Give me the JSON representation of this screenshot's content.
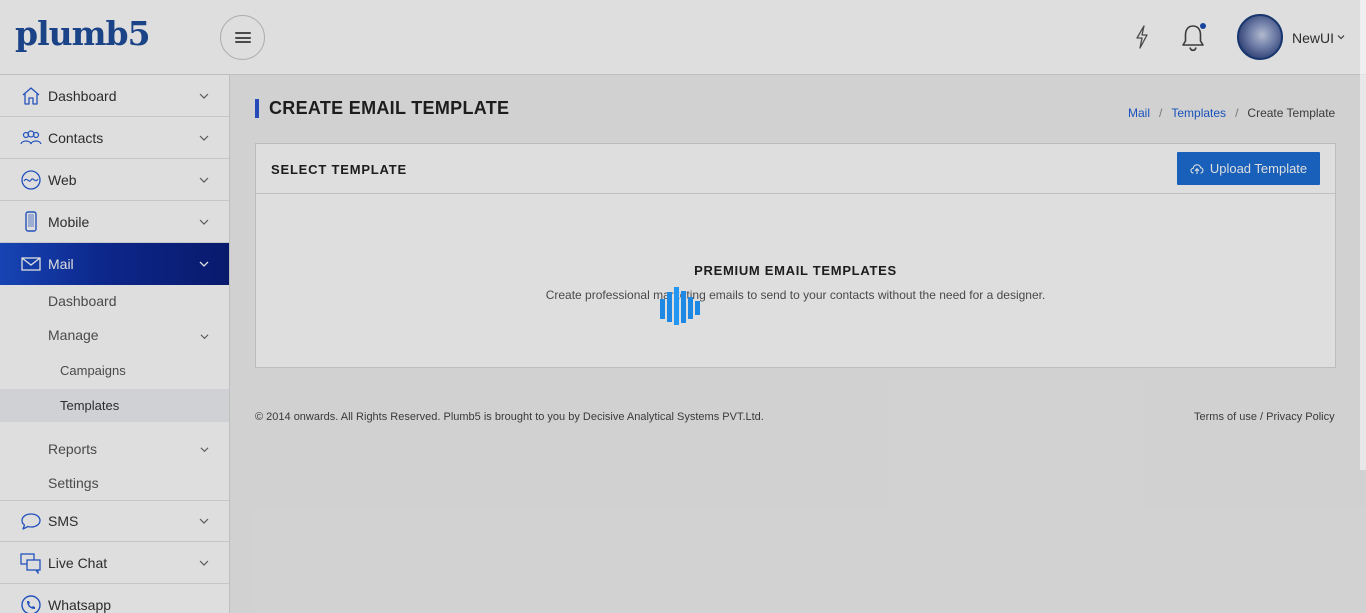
{
  "header": {
    "logo_text": "plumb5",
    "user_name": "NewUI"
  },
  "sidebar": {
    "items": [
      {
        "label": "Dashboard",
        "icon": "home-icon"
      },
      {
        "label": "Contacts",
        "icon": "contacts-icon"
      },
      {
        "label": "Web",
        "icon": "web-icon"
      },
      {
        "label": "Mobile",
        "icon": "mobile-icon"
      },
      {
        "label": "Mail",
        "icon": "mail-icon",
        "active": true
      },
      {
        "label": "SMS",
        "icon": "sms-icon"
      },
      {
        "label": "Live Chat",
        "icon": "live-chat-icon"
      },
      {
        "label": "Whatsapp",
        "icon": "whatsapp-icon"
      }
    ],
    "mail_sub": {
      "dashboard": "Dashboard",
      "manage": "Manage",
      "campaigns": "Campaigns",
      "templates": "Templates",
      "reports": "Reports",
      "settings": "Settings"
    }
  },
  "page": {
    "title": "CREATE EMAIL TEMPLATE",
    "breadcrumb": [
      "Mail",
      "Templates",
      "Create Template"
    ]
  },
  "card": {
    "title": "SELECT TEMPLATE",
    "upload_label": "Upload Template",
    "premium_title": "PREMIUM EMAIL TEMPLATES",
    "premium_subtitle": "Create professional marketing emails to send to your contacts without the need for a designer."
  },
  "footer": {
    "copyright": "© 2014 onwards. All Rights Reserved. Plumb5 is brought to you by Decisive Analytical Systems PVT.Ltd.",
    "terms": "Terms of use",
    "separator": "/",
    "privacy": "Privacy Policy"
  },
  "colors": {
    "accent": "#1c6fd6",
    "brand": "#1f4e9c",
    "active_nav": "#0f2da0"
  }
}
